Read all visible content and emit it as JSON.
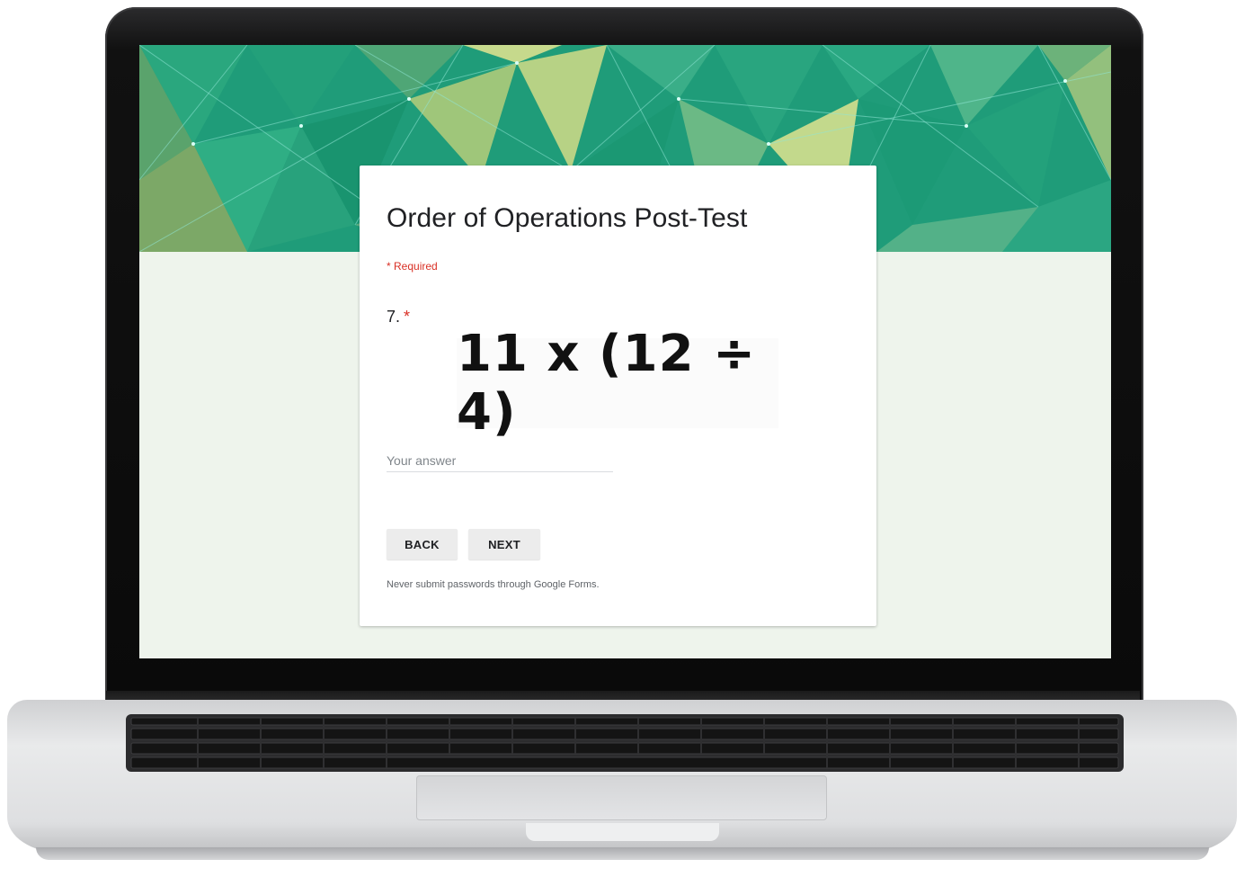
{
  "form": {
    "title": "Order of Operations Post-Test",
    "required_note": "* Required",
    "question": {
      "number": "7.",
      "required_marker": "*",
      "expression": "11 x (12 ÷ 4)"
    },
    "answer": {
      "placeholder": "Your answer",
      "value": ""
    },
    "buttons": {
      "back_label": "BACK",
      "next_label": "NEXT"
    },
    "footer_note": "Never submit passwords through Google Forms."
  },
  "theme": {
    "header_color": "#1f9c79",
    "page_background": "#eef4ec",
    "required_color": "#d93025"
  }
}
